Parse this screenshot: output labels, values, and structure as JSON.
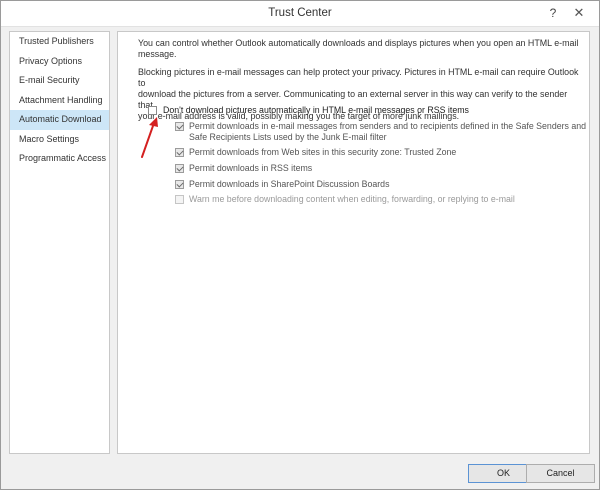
{
  "window": {
    "title": "Trust Center",
    "help_glyph": "?",
    "close_glyph": "✕"
  },
  "sidebar": {
    "items": [
      {
        "label": "Trusted Publishers"
      },
      {
        "label": "Privacy Options"
      },
      {
        "label": "E-mail Security"
      },
      {
        "label": "Attachment Handling"
      },
      {
        "label": "Automatic Download"
      },
      {
        "label": "Macro Settings"
      },
      {
        "label": "Programmatic Access"
      }
    ],
    "selected_index": 4
  },
  "main": {
    "intro_line1": "You can control whether Outlook automatically downloads and displays pictures when you open an HTML e-mail",
    "intro_line2": "message.",
    "para2_line1": "Blocking pictures in e-mail messages can help protect your privacy. Pictures in HTML e-mail can require Outlook to",
    "para2_line2": "download the pictures from a server. Communicating to an external server in this way can verify to the sender that",
    "para2_line3": "your e-mail address is valid, possibly making you the target of more junk mailings.",
    "options": [
      {
        "label": "Don't download pictures automatically in HTML e-mail messages or RSS items",
        "checked": false,
        "enabled": true
      },
      {
        "label_line1": "Permit downloads in e-mail messages from senders and to recipients defined in the Safe Senders and",
        "label_line2": "Safe Recipients Lists used by the Junk E-mail filter",
        "checked": true,
        "enabled": true
      },
      {
        "label": "Permit downloads from Web sites in this security zone: Trusted Zone",
        "checked": true,
        "enabled": true
      },
      {
        "label": "Permit downloads in RSS items",
        "checked": true,
        "enabled": true
      },
      {
        "label": "Permit downloads in SharePoint Discussion Boards",
        "checked": true,
        "enabled": true
      },
      {
        "label": "Warn me before downloading content when editing, forwarding, or replying to e-mail",
        "checked": false,
        "enabled": false
      }
    ]
  },
  "footer": {
    "ok_label": "OK",
    "cancel_label": "Cancel"
  },
  "colors": {
    "selection": "#cde6f7",
    "arrow": "#d42020"
  }
}
